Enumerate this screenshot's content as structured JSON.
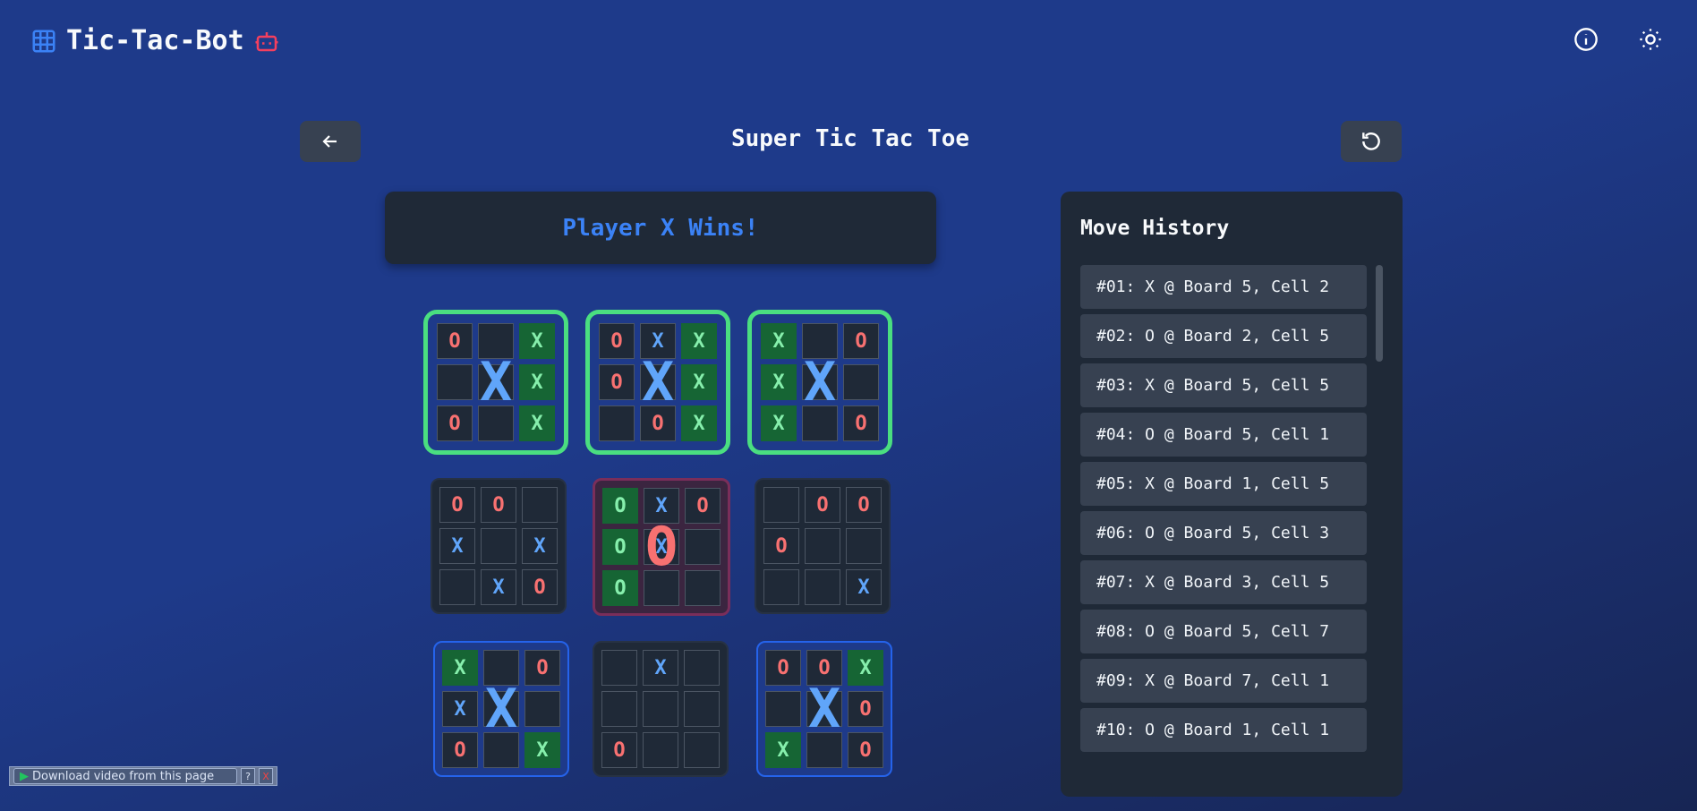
{
  "brand": {
    "name": "Tic-Tac-Bot"
  },
  "page": {
    "title": "Super Tic Tac Toe"
  },
  "status": {
    "text": "Player X Wins!"
  },
  "boards": [
    {
      "cells": [
        "O",
        "",
        "X",
        "",
        "",
        "X",
        "O",
        "",
        "X"
      ],
      "win": [
        2,
        5,
        8
      ],
      "winner": "X",
      "highlight": true,
      "active": false
    },
    {
      "cells": [
        "O",
        "X",
        "X",
        "O",
        "",
        "X",
        "",
        "O",
        "X"
      ],
      "win": [
        2,
        5,
        8
      ],
      "winner": "X",
      "highlight": true,
      "active": false
    },
    {
      "cells": [
        "X",
        "",
        "O",
        "X",
        "",
        "",
        "X",
        "",
        "O"
      ],
      "win": [
        0,
        3,
        6
      ],
      "winner": "X",
      "highlight": true,
      "active": false
    },
    {
      "cells": [
        "O",
        "O",
        "",
        "X",
        "",
        "X",
        "",
        "X",
        "O"
      ],
      "win": [],
      "winner": "",
      "highlight": false,
      "active": false
    },
    {
      "cells": [
        "O",
        "X",
        "O",
        "O",
        "X",
        "",
        "O",
        "",
        ""
      ],
      "win": [
        0,
        3,
        6
      ],
      "winner": "O",
      "highlight": false,
      "active": true
    },
    {
      "cells": [
        "",
        "O",
        "O",
        "O",
        "",
        "",
        "",
        "",
        "X"
      ],
      "win": [],
      "winner": "",
      "highlight": false,
      "active": false
    },
    {
      "cells": [
        "X",
        "",
        "O",
        "X",
        "",
        "",
        "O",
        "",
        "X"
      ],
      "win": [
        0,
        8
      ],
      "winner": "X",
      "highlight": false,
      "active": false
    },
    {
      "cells": [
        "",
        "X",
        "",
        "",
        "",
        "",
        "O",
        "",
        ""
      ],
      "win": [],
      "winner": "",
      "highlight": false,
      "active": false
    },
    {
      "cells": [
        "O",
        "O",
        "X",
        "",
        "",
        "O",
        "X",
        "",
        "O"
      ],
      "win": [
        2,
        6
      ],
      "winner": "X",
      "highlight": false,
      "active": false
    }
  ],
  "history": {
    "title": "Move History",
    "items": [
      "#01: X @ Board 5, Cell 2",
      "#02: O @ Board 2, Cell 5",
      "#03: X @ Board 5, Cell 5",
      "#04: O @ Board 5, Cell 1",
      "#05: X @ Board 1, Cell 5",
      "#06: O @ Board 5, Cell 3",
      "#07: X @ Board 3, Cell 5",
      "#08: O @ Board 5, Cell 7",
      "#09: X @ Board 7, Cell 1",
      "#10: O @ Board 1, Cell 1"
    ]
  },
  "download_bar": {
    "label": "Download video from this page",
    "help": "?",
    "close": "X"
  },
  "colors": {
    "accent": "#3b82f6",
    "x": "#60a5fa",
    "o": "#f87171",
    "win_highlight": "#4ade80",
    "robot": "#f43f5e"
  }
}
